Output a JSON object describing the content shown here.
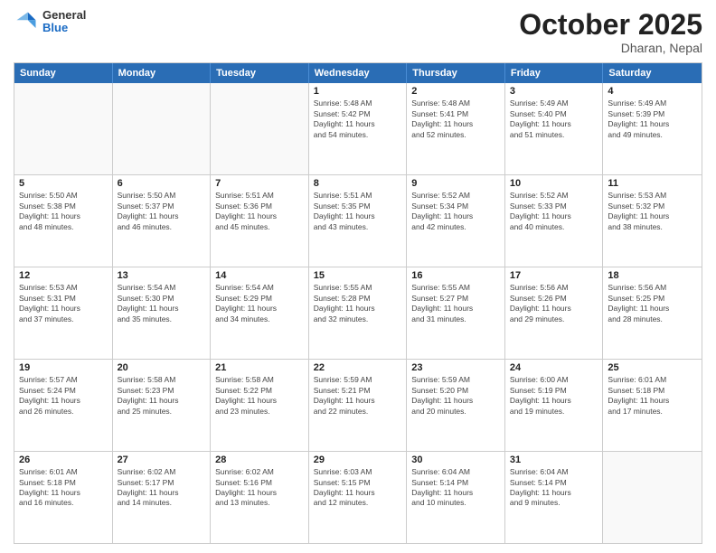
{
  "logo": {
    "general": "General",
    "blue": "Blue"
  },
  "title": "October 2025",
  "location": "Dharan, Nepal",
  "days": [
    "Sunday",
    "Monday",
    "Tuesday",
    "Wednesday",
    "Thursday",
    "Friday",
    "Saturday"
  ],
  "weeks": [
    [
      {
        "day": "",
        "info": ""
      },
      {
        "day": "",
        "info": ""
      },
      {
        "day": "",
        "info": ""
      },
      {
        "day": "1",
        "info": "Sunrise: 5:48 AM\nSunset: 5:42 PM\nDaylight: 11 hours\nand 54 minutes."
      },
      {
        "day": "2",
        "info": "Sunrise: 5:48 AM\nSunset: 5:41 PM\nDaylight: 11 hours\nand 52 minutes."
      },
      {
        "day": "3",
        "info": "Sunrise: 5:49 AM\nSunset: 5:40 PM\nDaylight: 11 hours\nand 51 minutes."
      },
      {
        "day": "4",
        "info": "Sunrise: 5:49 AM\nSunset: 5:39 PM\nDaylight: 11 hours\nand 49 minutes."
      }
    ],
    [
      {
        "day": "5",
        "info": "Sunrise: 5:50 AM\nSunset: 5:38 PM\nDaylight: 11 hours\nand 48 minutes."
      },
      {
        "day": "6",
        "info": "Sunrise: 5:50 AM\nSunset: 5:37 PM\nDaylight: 11 hours\nand 46 minutes."
      },
      {
        "day": "7",
        "info": "Sunrise: 5:51 AM\nSunset: 5:36 PM\nDaylight: 11 hours\nand 45 minutes."
      },
      {
        "day": "8",
        "info": "Sunrise: 5:51 AM\nSunset: 5:35 PM\nDaylight: 11 hours\nand 43 minutes."
      },
      {
        "day": "9",
        "info": "Sunrise: 5:52 AM\nSunset: 5:34 PM\nDaylight: 11 hours\nand 42 minutes."
      },
      {
        "day": "10",
        "info": "Sunrise: 5:52 AM\nSunset: 5:33 PM\nDaylight: 11 hours\nand 40 minutes."
      },
      {
        "day": "11",
        "info": "Sunrise: 5:53 AM\nSunset: 5:32 PM\nDaylight: 11 hours\nand 38 minutes."
      }
    ],
    [
      {
        "day": "12",
        "info": "Sunrise: 5:53 AM\nSunset: 5:31 PM\nDaylight: 11 hours\nand 37 minutes."
      },
      {
        "day": "13",
        "info": "Sunrise: 5:54 AM\nSunset: 5:30 PM\nDaylight: 11 hours\nand 35 minutes."
      },
      {
        "day": "14",
        "info": "Sunrise: 5:54 AM\nSunset: 5:29 PM\nDaylight: 11 hours\nand 34 minutes."
      },
      {
        "day": "15",
        "info": "Sunrise: 5:55 AM\nSunset: 5:28 PM\nDaylight: 11 hours\nand 32 minutes."
      },
      {
        "day": "16",
        "info": "Sunrise: 5:55 AM\nSunset: 5:27 PM\nDaylight: 11 hours\nand 31 minutes."
      },
      {
        "day": "17",
        "info": "Sunrise: 5:56 AM\nSunset: 5:26 PM\nDaylight: 11 hours\nand 29 minutes."
      },
      {
        "day": "18",
        "info": "Sunrise: 5:56 AM\nSunset: 5:25 PM\nDaylight: 11 hours\nand 28 minutes."
      }
    ],
    [
      {
        "day": "19",
        "info": "Sunrise: 5:57 AM\nSunset: 5:24 PM\nDaylight: 11 hours\nand 26 minutes."
      },
      {
        "day": "20",
        "info": "Sunrise: 5:58 AM\nSunset: 5:23 PM\nDaylight: 11 hours\nand 25 minutes."
      },
      {
        "day": "21",
        "info": "Sunrise: 5:58 AM\nSunset: 5:22 PM\nDaylight: 11 hours\nand 23 minutes."
      },
      {
        "day": "22",
        "info": "Sunrise: 5:59 AM\nSunset: 5:21 PM\nDaylight: 11 hours\nand 22 minutes."
      },
      {
        "day": "23",
        "info": "Sunrise: 5:59 AM\nSunset: 5:20 PM\nDaylight: 11 hours\nand 20 minutes."
      },
      {
        "day": "24",
        "info": "Sunrise: 6:00 AM\nSunset: 5:19 PM\nDaylight: 11 hours\nand 19 minutes."
      },
      {
        "day": "25",
        "info": "Sunrise: 6:01 AM\nSunset: 5:18 PM\nDaylight: 11 hours\nand 17 minutes."
      }
    ],
    [
      {
        "day": "26",
        "info": "Sunrise: 6:01 AM\nSunset: 5:18 PM\nDaylight: 11 hours\nand 16 minutes."
      },
      {
        "day": "27",
        "info": "Sunrise: 6:02 AM\nSunset: 5:17 PM\nDaylight: 11 hours\nand 14 minutes."
      },
      {
        "day": "28",
        "info": "Sunrise: 6:02 AM\nSunset: 5:16 PM\nDaylight: 11 hours\nand 13 minutes."
      },
      {
        "day": "29",
        "info": "Sunrise: 6:03 AM\nSunset: 5:15 PM\nDaylight: 11 hours\nand 12 minutes."
      },
      {
        "day": "30",
        "info": "Sunrise: 6:04 AM\nSunset: 5:14 PM\nDaylight: 11 hours\nand 10 minutes."
      },
      {
        "day": "31",
        "info": "Sunrise: 6:04 AM\nSunset: 5:14 PM\nDaylight: 11 hours\nand 9 minutes."
      },
      {
        "day": "",
        "info": ""
      }
    ]
  ]
}
